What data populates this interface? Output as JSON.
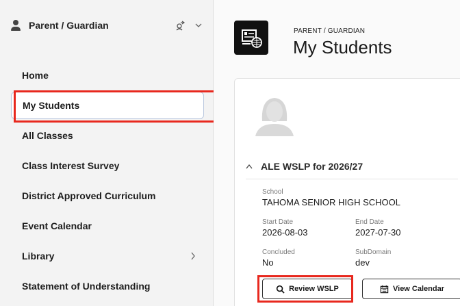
{
  "sidebar": {
    "role_label": "Parent / Guardian",
    "nav_items": [
      {
        "label": "Home"
      },
      {
        "label": "My Students"
      },
      {
        "label": "All Classes"
      },
      {
        "label": "Class Interest Survey"
      },
      {
        "label": "District Approved Curriculum"
      },
      {
        "label": "Event Calendar"
      },
      {
        "label": "Library"
      },
      {
        "label": "Statement of Understanding"
      }
    ]
  },
  "header": {
    "eyebrow": "PARENT / GUARDIAN",
    "title": "My Students"
  },
  "student_card": {
    "plan_title": "ALE WSLP for 2026/27",
    "school_label": "School",
    "school_value": "TAHOMA SENIOR HIGH SCHOOL",
    "start_label": "Start Date",
    "start_value": "2026-08-03",
    "end_label": "End Date",
    "end_value": "2027-07-30",
    "concluded_label": "Concluded",
    "concluded_value": "No",
    "subdomain_label": "SubDomain",
    "subdomain_value": "dev",
    "review_button": "Review WSLP",
    "calendar_button": "View Calendar"
  },
  "colors": {
    "highlight": "#e8281e",
    "active_border": "#b9c7de",
    "sidebar_bg": "#f3f3f3"
  }
}
